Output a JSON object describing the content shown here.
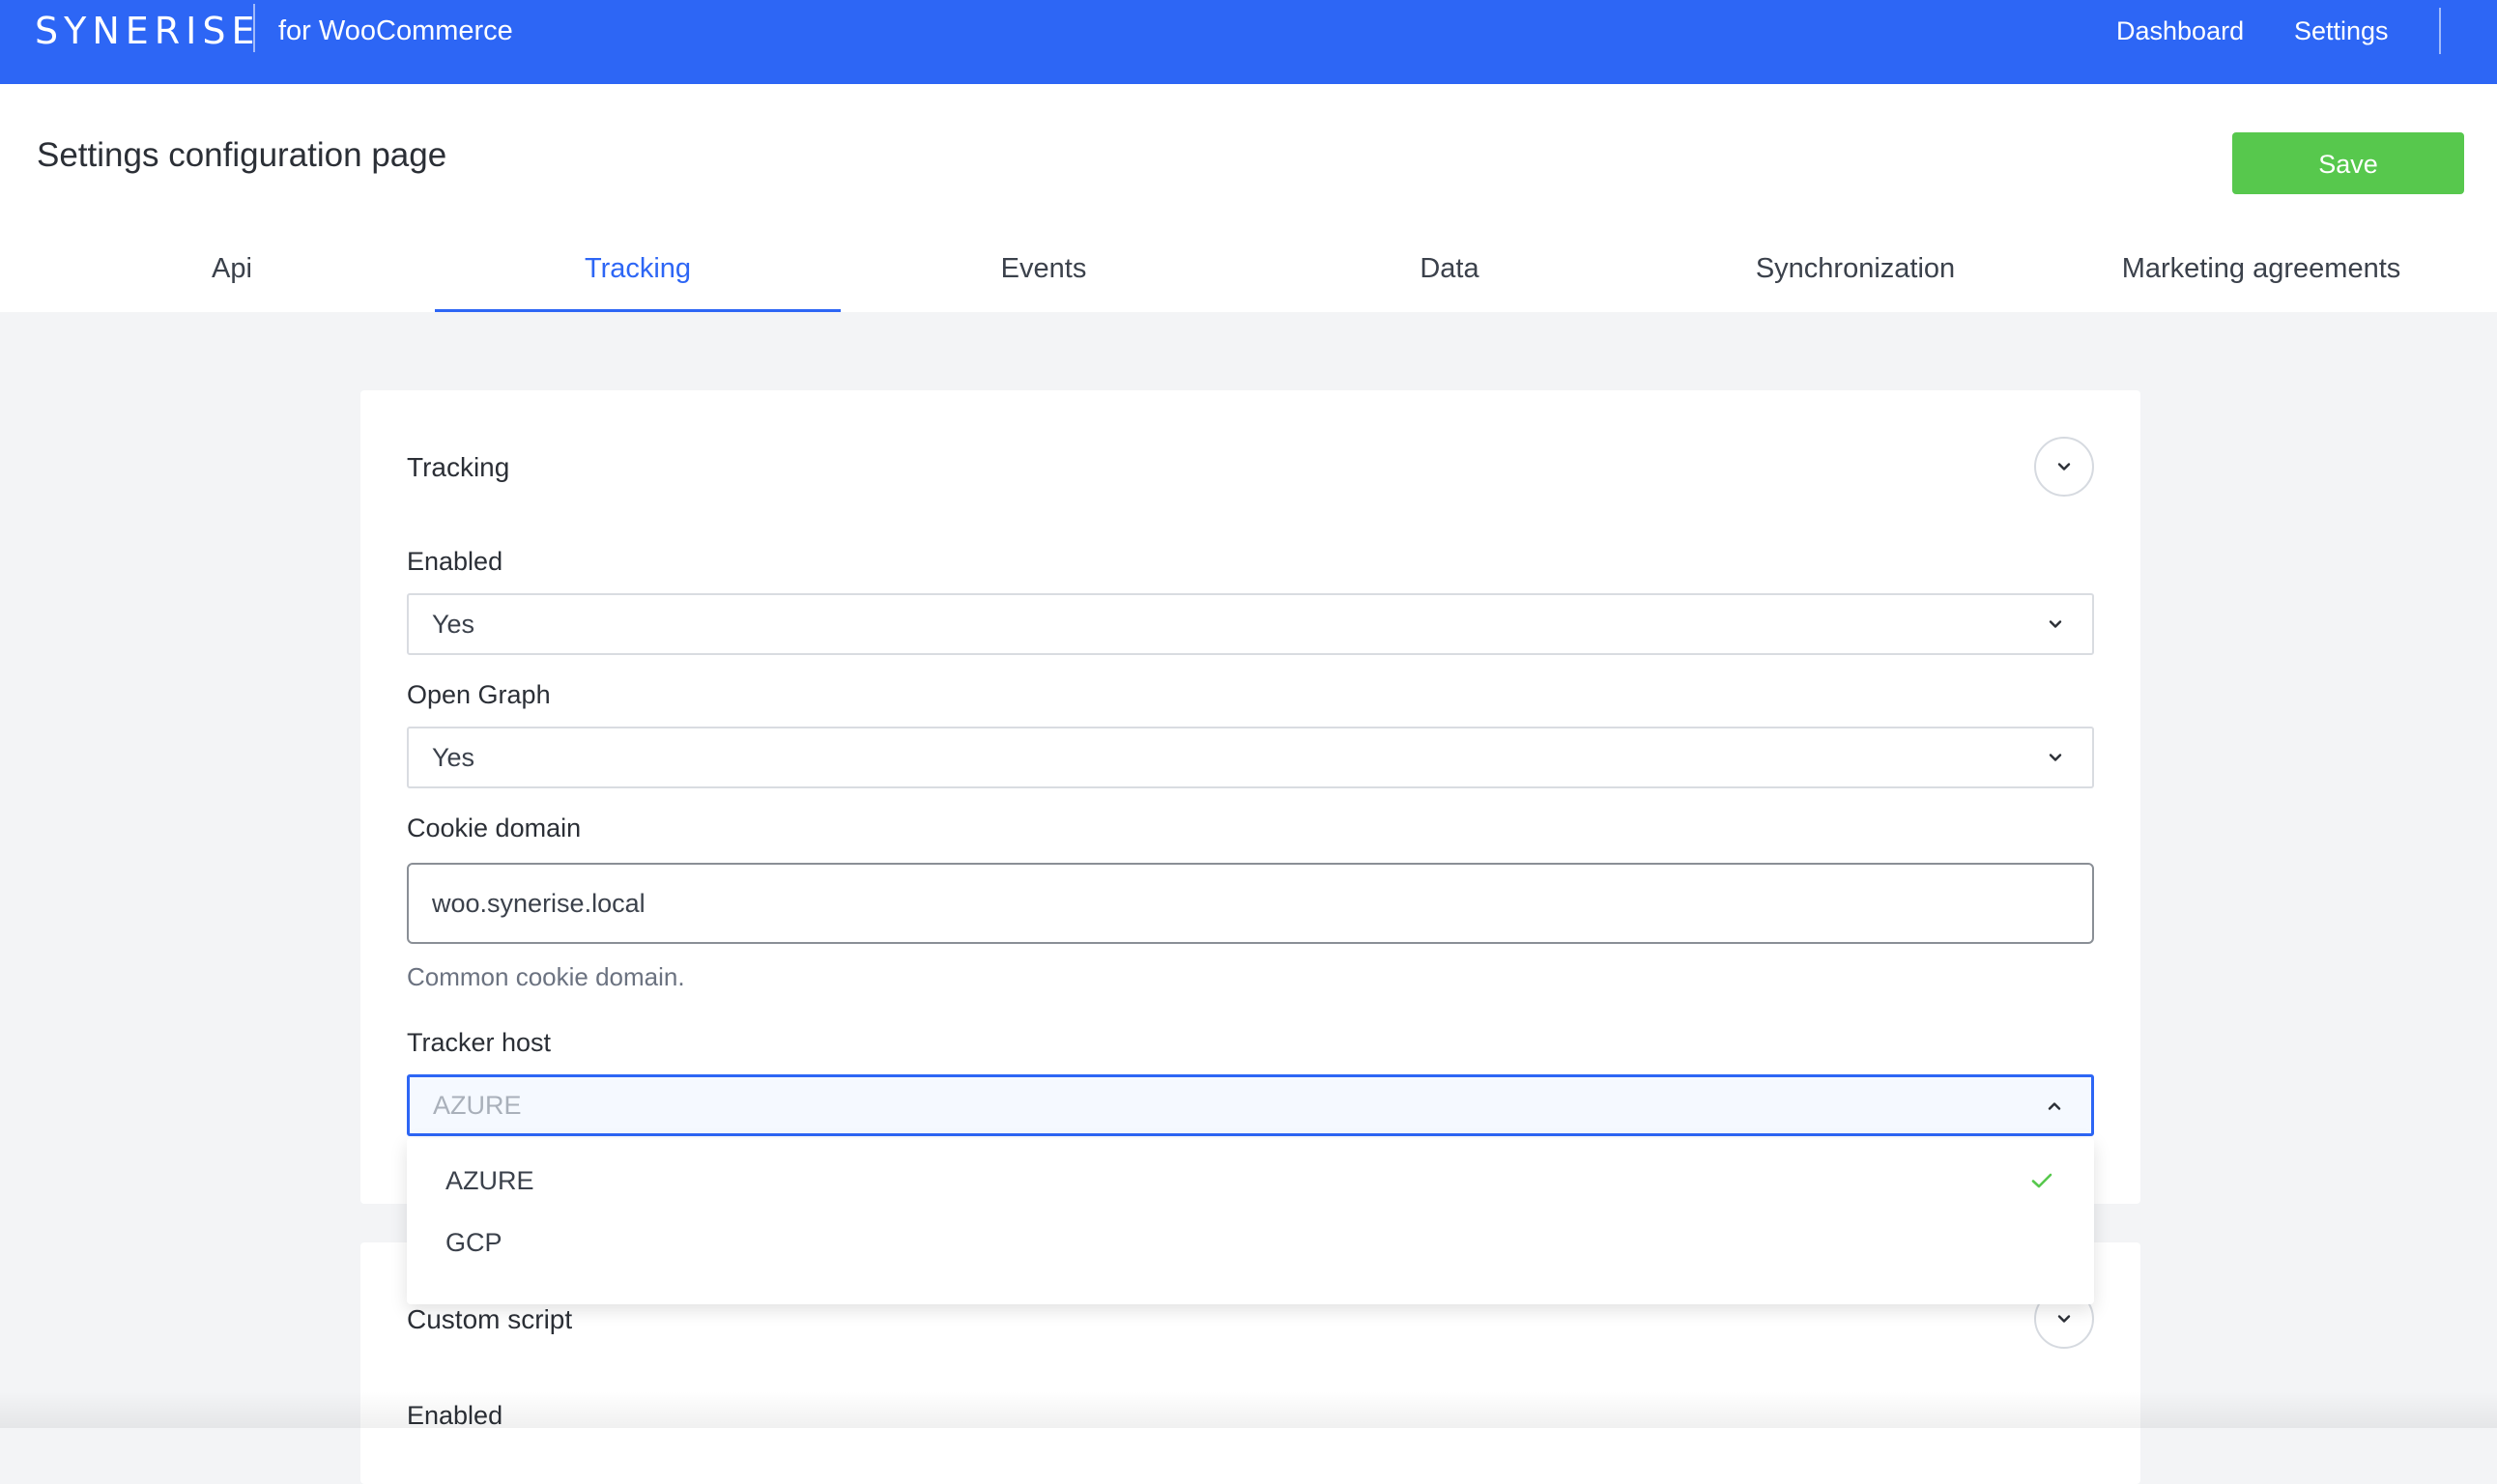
{
  "app": {
    "logo": "synerise",
    "subtitle": "for WooCommerce",
    "nav": {
      "dashboard": "Dashboard",
      "settings": "Settings"
    },
    "brand_color": "#2d66f5"
  },
  "page": {
    "title": "Settings configuration page",
    "save_label": "Save",
    "save_color": "#57c84d"
  },
  "tabs": [
    {
      "label": "Api",
      "active": false
    },
    {
      "label": "Tracking",
      "active": true
    },
    {
      "label": "Events",
      "active": false
    },
    {
      "label": "Data",
      "active": false
    },
    {
      "label": "Synchronization",
      "active": false
    },
    {
      "label": "Marketing agreements",
      "active": false
    }
  ],
  "tracking_section": {
    "title": "Tracking",
    "collapse_icon": "chevron-down-icon",
    "fields": {
      "enabled": {
        "label": "Enabled",
        "value": "Yes"
      },
      "open_graph": {
        "label": "Open Graph",
        "value": "Yes"
      },
      "cookie_domain": {
        "label": "Cookie domain",
        "value": "woo.synerise.local",
        "help": "Common cookie domain."
      },
      "tracker_host": {
        "label": "Tracker host",
        "value": "AZURE",
        "open": true,
        "options": [
          {
            "label": "AZURE",
            "selected": true
          },
          {
            "label": "GCP",
            "selected": false
          }
        ]
      }
    }
  },
  "custom_script_section": {
    "title": "Custom script",
    "collapse_icon": "chevron-down-icon",
    "fields": {
      "enabled": {
        "label": "Enabled"
      }
    }
  }
}
